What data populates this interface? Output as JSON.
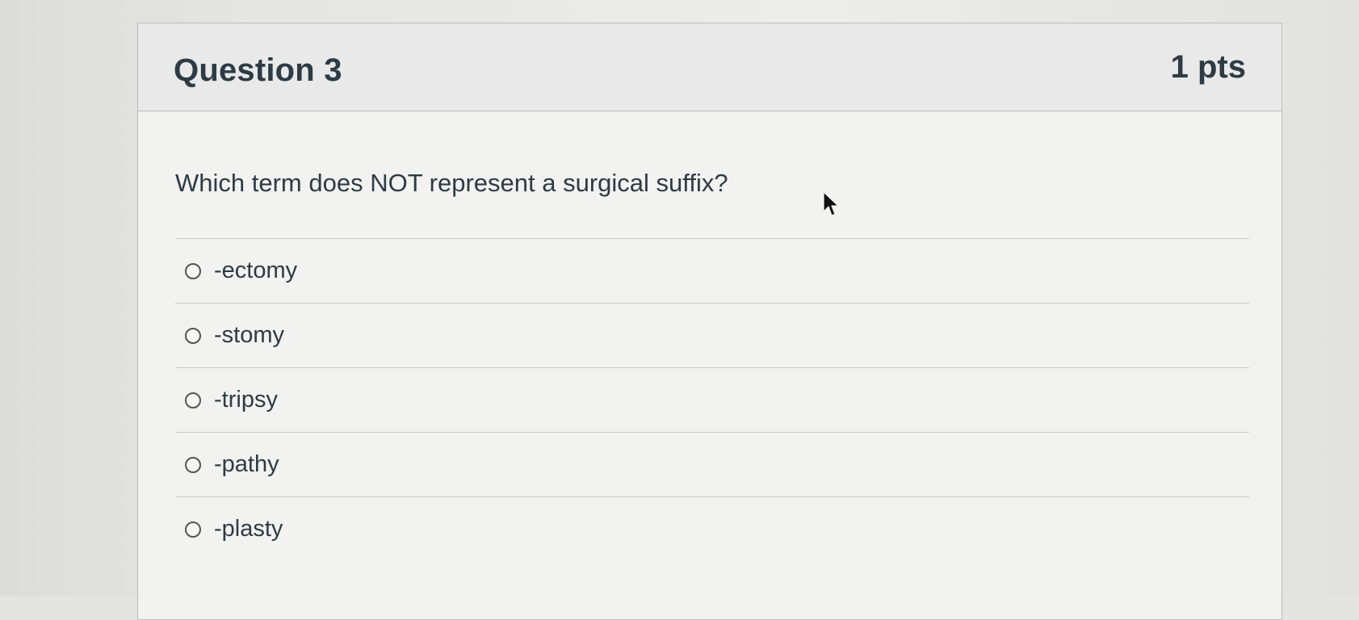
{
  "question": {
    "title": "Question 3",
    "points": "1 pts",
    "text": "Which term does NOT represent a surgical suffix?"
  },
  "answers": [
    {
      "label": "-ectomy",
      "selected": false
    },
    {
      "label": "-stomy",
      "selected": false
    },
    {
      "label": "-tripsy",
      "selected": false
    },
    {
      "label": "-pathy",
      "selected": false
    },
    {
      "label": "-plasty",
      "selected": false
    }
  ],
  "icons": {
    "radio": "radio-button-icon",
    "cursor": "mouse-pointer-icon"
  },
  "colors": {
    "text": "#2d3b45",
    "header_bg": "#e8e9e8",
    "card_bg": "#f2f2f0",
    "border": "#b9bcbd"
  }
}
